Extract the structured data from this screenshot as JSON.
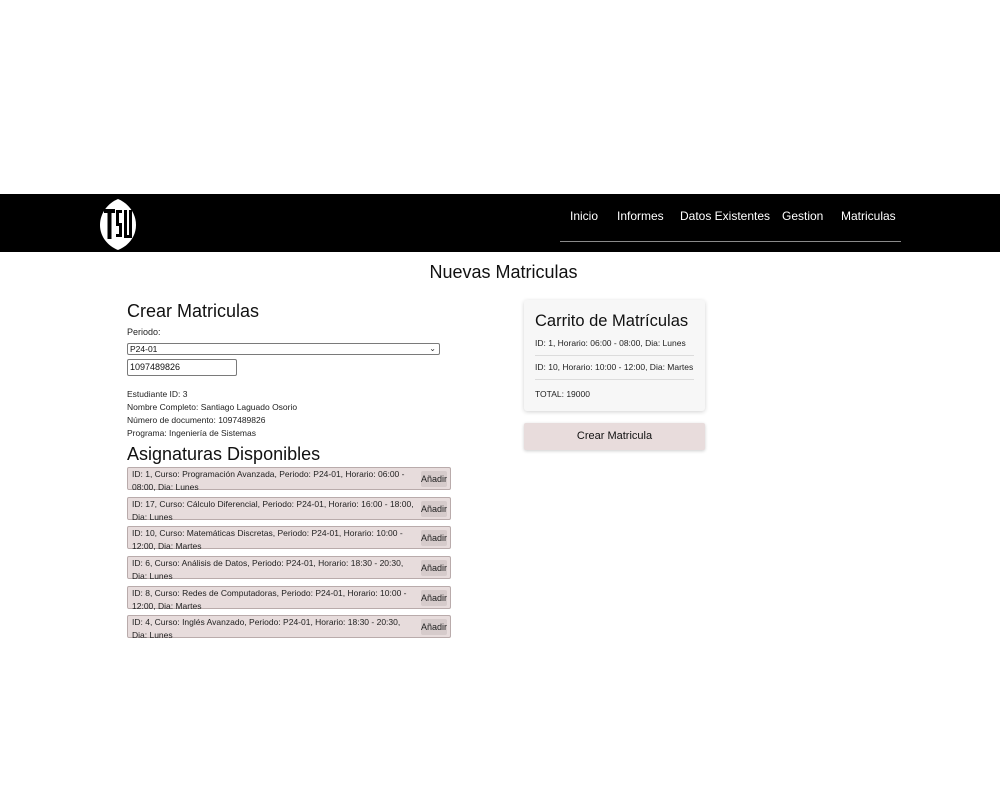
{
  "navbar": {
    "logo_text": "TSU",
    "links": [
      "Inicio",
      "Informes",
      "Datos Existentes",
      "Gestion",
      "Matriculas"
    ]
  },
  "page_title": "Nuevas Matriculas",
  "create_section": {
    "title": "Crear Matriculas",
    "period_label": "Periodo:",
    "period_selected": "P24-01",
    "document_value": "1097489826"
  },
  "student": {
    "id_line": "Estudiante ID: 3",
    "name_line": "Nombre Completo: Santiago Laguado Osorio",
    "document_line": "Número de documento: 1097489826",
    "program_line": "Programa: Ingeniería de Sistemas"
  },
  "courses_section": {
    "title": "Asignaturas Disponibles",
    "add_label": "Añadir",
    "items": [
      "ID: 1, Curso: Programación Avanzada, Periodo: P24-01, Horario: 06:00 - 08:00, Dia: Lunes",
      "ID: 17, Curso: Cálculo Diferencial, Periodo: P24-01, Horario: 16:00 - 18:00, Dia: Lunes",
      "ID: 10, Curso: Matemáticas Discretas, Periodo: P24-01, Horario: 10:00 - 12:00, Dia: Martes",
      "ID: 6, Curso: Análisis de Datos, Periodo: P24-01, Horario: 18:30 - 20:30, Dia: Lunes",
      "ID: 8, Curso: Redes de Computadoras, Periodo: P24-01, Horario: 10:00 - 12:00, Dia: Martes",
      "ID: 4, Curso: Inglés Avanzado, Periodo: P24-01, Horario: 18:30 - 20:30, Dia: Lunes"
    ]
  },
  "cart": {
    "title": "Carrito de Matrículas",
    "items": [
      "ID: 1, Horario: 06:00 - 08:00, Dia: Lunes",
      "ID: 10, Horario: 10:00 - 12:00, Dia: Martes"
    ],
    "total": "TOTAL: 19000",
    "create_button": "Crear Matricula"
  }
}
